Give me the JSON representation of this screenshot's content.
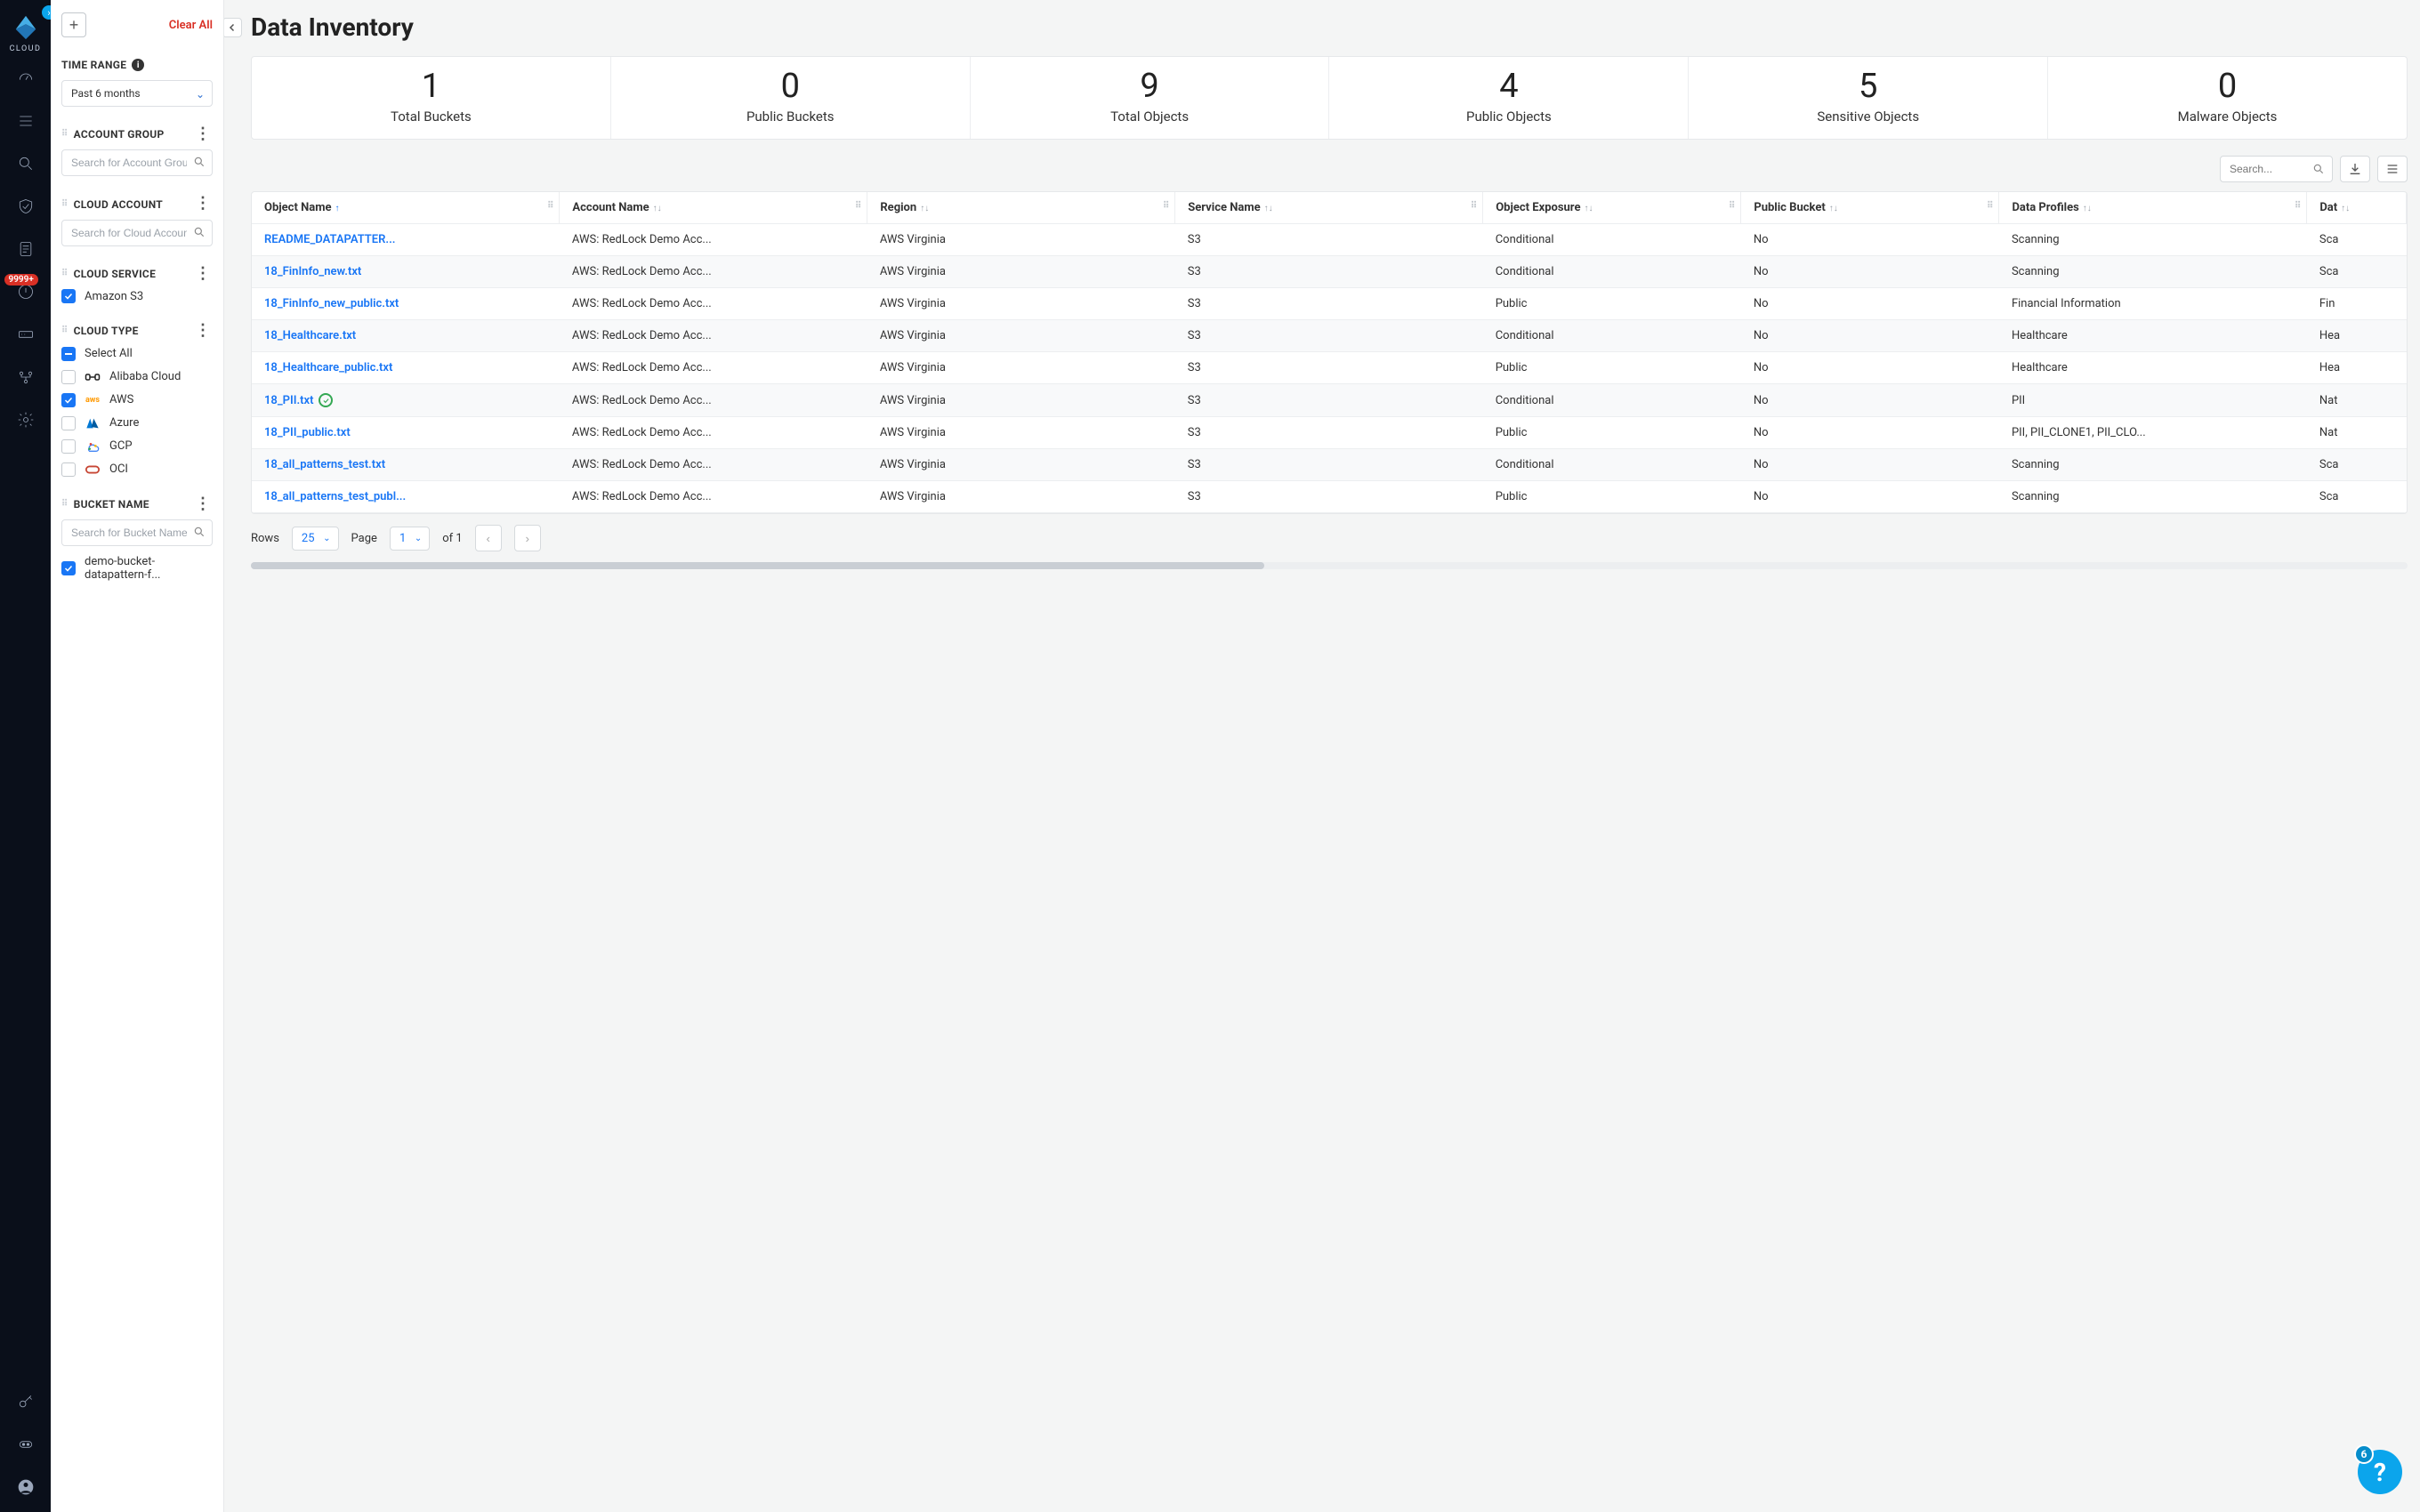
{
  "brand": {
    "text": "CLOUD"
  },
  "rail": {
    "badge_text": "9999+",
    "expand_arrow": "›"
  },
  "filters": {
    "clear_all": "Clear All",
    "time_range": {
      "title": "TIME RANGE",
      "value": "Past 6 months"
    },
    "account_group": {
      "title": "ACCOUNT GROUP",
      "placeholder": "Search for Account Group"
    },
    "cloud_account": {
      "title": "CLOUD ACCOUNT",
      "placeholder": "Search for Cloud Account"
    },
    "cloud_service": {
      "title": "CLOUD SERVICE",
      "items": [
        {
          "label": "Amazon S3",
          "checked": true
        }
      ]
    },
    "cloud_type": {
      "title": "CLOUD TYPE",
      "select_all": "Select All",
      "items": [
        {
          "label": "Alibaba Cloud",
          "checked": false
        },
        {
          "label": "AWS",
          "checked": true
        },
        {
          "label": "Azure",
          "checked": false
        },
        {
          "label": "GCP",
          "checked": false
        },
        {
          "label": "OCI",
          "checked": false
        }
      ]
    },
    "bucket_name": {
      "title": "BUCKET NAME",
      "placeholder": "Search for Bucket Name",
      "items": [
        {
          "label": "demo-bucket-datapattern-f...",
          "checked": true
        }
      ]
    }
  },
  "page": {
    "title": "Data Inventory",
    "search_placeholder": "Search...",
    "stats": [
      {
        "value": "1",
        "label": "Total Buckets"
      },
      {
        "value": "0",
        "label": "Public Buckets"
      },
      {
        "value": "9",
        "label": "Total Objects"
      },
      {
        "value": "4",
        "label": "Public Objects"
      },
      {
        "value": "5",
        "label": "Sensitive Objects"
      },
      {
        "value": "0",
        "label": "Malware Objects"
      }
    ],
    "columns": [
      "Object Name",
      "Account Name",
      "Region",
      "Service Name",
      "Object Exposure",
      "Public Bucket",
      "Data Profiles",
      "Dat"
    ],
    "rows": [
      {
        "object": "README_DATAPATTER...",
        "account": "AWS: RedLock Demo Acc...",
        "region": "AWS Virginia",
        "service": "S3",
        "exposure": "Conditional",
        "public": "No",
        "profiles": "Scanning",
        "patterns": "Sca",
        "verified": false
      },
      {
        "object": "18_FinInfo_new.txt",
        "account": "AWS: RedLock Demo Acc...",
        "region": "AWS Virginia",
        "service": "S3",
        "exposure": "Conditional",
        "public": "No",
        "profiles": "Scanning",
        "patterns": "Sca",
        "verified": false
      },
      {
        "object": "18_FinInfo_new_public.txt",
        "account": "AWS: RedLock Demo Acc...",
        "region": "AWS Virginia",
        "service": "S3",
        "exposure": "Public",
        "public": "No",
        "profiles": "Financial Information",
        "patterns": "Fin",
        "verified": false
      },
      {
        "object": "18_Healthcare.txt",
        "account": "AWS: RedLock Demo Acc...",
        "region": "AWS Virginia",
        "service": "S3",
        "exposure": "Conditional",
        "public": "No",
        "profiles": "Healthcare",
        "patterns": "Hea",
        "verified": false
      },
      {
        "object": "18_Healthcare_public.txt",
        "account": "AWS: RedLock Demo Acc...",
        "region": "AWS Virginia",
        "service": "S3",
        "exposure": "Public",
        "public": "No",
        "profiles": "Healthcare",
        "patterns": "Hea",
        "verified": false
      },
      {
        "object": "18_PII.txt",
        "account": "AWS: RedLock Demo Acc...",
        "region": "AWS Virginia",
        "service": "S3",
        "exposure": "Conditional",
        "public": "No",
        "profiles": "PII",
        "patterns": "Nat",
        "verified": true
      },
      {
        "object": "18_PII_public.txt",
        "account": "AWS: RedLock Demo Acc...",
        "region": "AWS Virginia",
        "service": "S3",
        "exposure": "Public",
        "public": "No",
        "profiles": "PII, PII_CLONE1, PII_CLO...",
        "patterns": "Nat",
        "verified": false
      },
      {
        "object": "18_all_patterns_test.txt",
        "account": "AWS: RedLock Demo Acc...",
        "region": "AWS Virginia",
        "service": "S3",
        "exposure": "Conditional",
        "public": "No",
        "profiles": "Scanning",
        "patterns": "Sca",
        "verified": false
      },
      {
        "object": "18_all_patterns_test_publ...",
        "account": "AWS: RedLock Demo Acc...",
        "region": "AWS Virginia",
        "service": "S3",
        "exposure": "Public",
        "public": "No",
        "profiles": "Scanning",
        "patterns": "Sca",
        "verified": false
      }
    ],
    "pagination": {
      "rows_label": "Rows",
      "rows_value": "25",
      "page_label": "Page",
      "page_value": "1",
      "of_text": "of 1"
    }
  },
  "help": {
    "count": "6"
  }
}
